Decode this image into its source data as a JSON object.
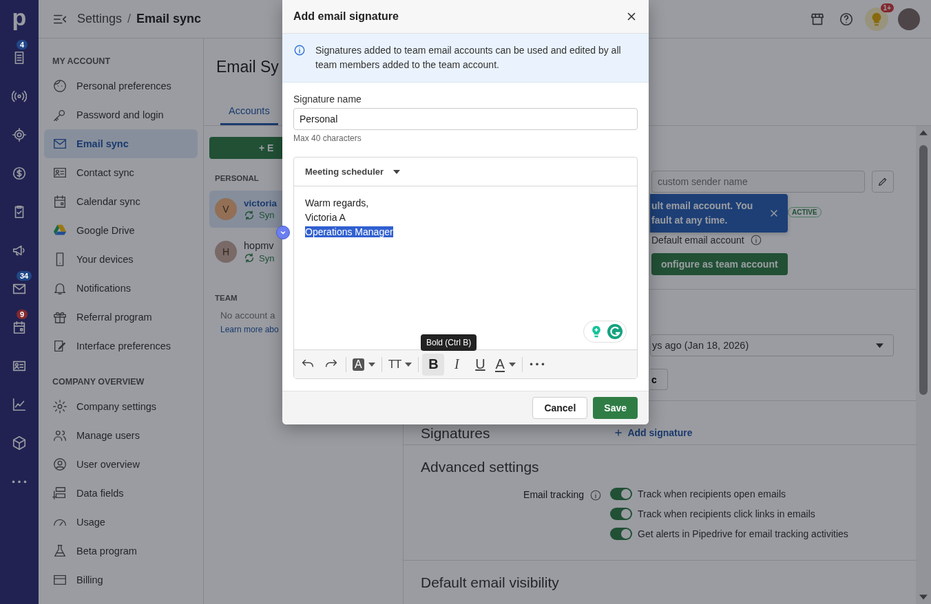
{
  "nav_rail": {
    "logo": "p",
    "badges": [
      {
        "text": "4",
        "color": "#214888"
      },
      {
        "text": "34",
        "color": "#214888"
      },
      {
        "text": "9",
        "color": "#822a2f"
      }
    ]
  },
  "topbar": {
    "breadcrumb_parent": "Settings",
    "separator": "/",
    "breadcrumb_current": "Email sync",
    "notification_badge": "1+"
  },
  "sidebar": {
    "sections": [
      {
        "title": "MY ACCOUNT",
        "items": [
          {
            "label": "Personal preferences",
            "selected": false
          },
          {
            "label": "Password and login",
            "selected": false
          },
          {
            "label": "Email sync",
            "selected": true
          },
          {
            "label": "Contact sync",
            "selected": false
          },
          {
            "label": "Calendar sync",
            "selected": false
          },
          {
            "label": "Google Drive",
            "selected": false
          },
          {
            "label": "Your devices",
            "selected": false
          },
          {
            "label": "Notifications",
            "selected": false
          },
          {
            "label": "Referral program",
            "selected": false
          },
          {
            "label": "Interface preferences",
            "selected": false
          }
        ]
      },
      {
        "title": "COMPANY OVERVIEW",
        "items": [
          {
            "label": "Company settings",
            "selected": false
          },
          {
            "label": "Manage users",
            "selected": false
          },
          {
            "label": "User overview",
            "selected": false
          },
          {
            "label": "Data fields",
            "selected": false
          },
          {
            "label": "Usage",
            "selected": false
          },
          {
            "label": "Beta program",
            "selected": false
          },
          {
            "label": "Billing",
            "selected": false
          }
        ]
      }
    ]
  },
  "page": {
    "title": "Email Sy",
    "tabs": [
      {
        "label": "Accounts",
        "selected": true
      }
    ]
  },
  "accounts": {
    "add_button": "+ E",
    "personal": {
      "title": "PERSONAL",
      "items": [
        {
          "initial": "V",
          "name": "victoria",
          "status": "Syn",
          "color": "#926f55",
          "selected": true
        },
        {
          "initial": "H",
          "name": "hopmv",
          "status": "Syn",
          "color": "#796967",
          "selected": false
        }
      ]
    },
    "team": {
      "title": "TEAM",
      "empty_text": "No account a",
      "link": "Learn more abo"
    }
  },
  "detail": {
    "sender_name": {
      "placeholder": "custom sender name"
    },
    "toast": {
      "lines": [
        "ult email account. You",
        "fault at any time."
      ]
    },
    "status_badge": "ACTIVE",
    "default_account": "Default email account",
    "configure_button": "onfigure as team account",
    "sync_select": "ys ago (Jan 18, 2026)",
    "sync_button": "c",
    "signatures": {
      "title": "Signatures",
      "add_link": "Add signature"
    },
    "advanced": {
      "title": "Advanced settings",
      "label": "Email tracking",
      "toggles": [
        {
          "label": "Track when recipients open emails",
          "on": true
        },
        {
          "label": "Track when recipients click links in emails",
          "on": true
        },
        {
          "label": "Get alerts in Pipedrive for email tracking activities",
          "on": true
        }
      ]
    },
    "visibility": {
      "title": "Default email visibility"
    }
  },
  "modal": {
    "title": "Add email signature",
    "info": "Signatures added to team email accounts can be used and edited by all team members added to the team account.",
    "field_label": "Signature name",
    "field_value": "Personal",
    "helper": "Max 40 characters",
    "editor": {
      "insert_menu": "Meeting scheduler",
      "lines": [
        {
          "text": "Warm regards,",
          "selected": false
        },
        {
          "text": "Victoria A",
          "selected": false
        },
        {
          "text": "Operations Manager",
          "selected": true
        }
      ],
      "tooltip": "Bold (Ctrl B)",
      "toolbar": [
        {
          "kind": "undo",
          "active": false
        },
        {
          "kind": "redo",
          "active": false
        },
        {
          "kind": "separator"
        },
        {
          "kind": "highlight",
          "glyph": "A",
          "dropdown": true,
          "active": false
        },
        {
          "kind": "separator"
        },
        {
          "kind": "size",
          "glyph": "TT",
          "dropdown": true,
          "active": false
        },
        {
          "kind": "separator"
        },
        {
          "kind": "bold",
          "glyph": "B",
          "active": true
        },
        {
          "kind": "italic",
          "glyph": "I",
          "active": false
        },
        {
          "kind": "underline",
          "glyph": "U",
          "active": false
        },
        {
          "kind": "color",
          "glyph": "A",
          "dropdown": true,
          "active": false
        },
        {
          "kind": "separator"
        },
        {
          "kind": "more",
          "active": false
        }
      ]
    },
    "buttons": [
      {
        "label": "Cancel",
        "kind": "secondary"
      },
      {
        "label": "Save",
        "kind": "primary"
      }
    ]
  }
}
